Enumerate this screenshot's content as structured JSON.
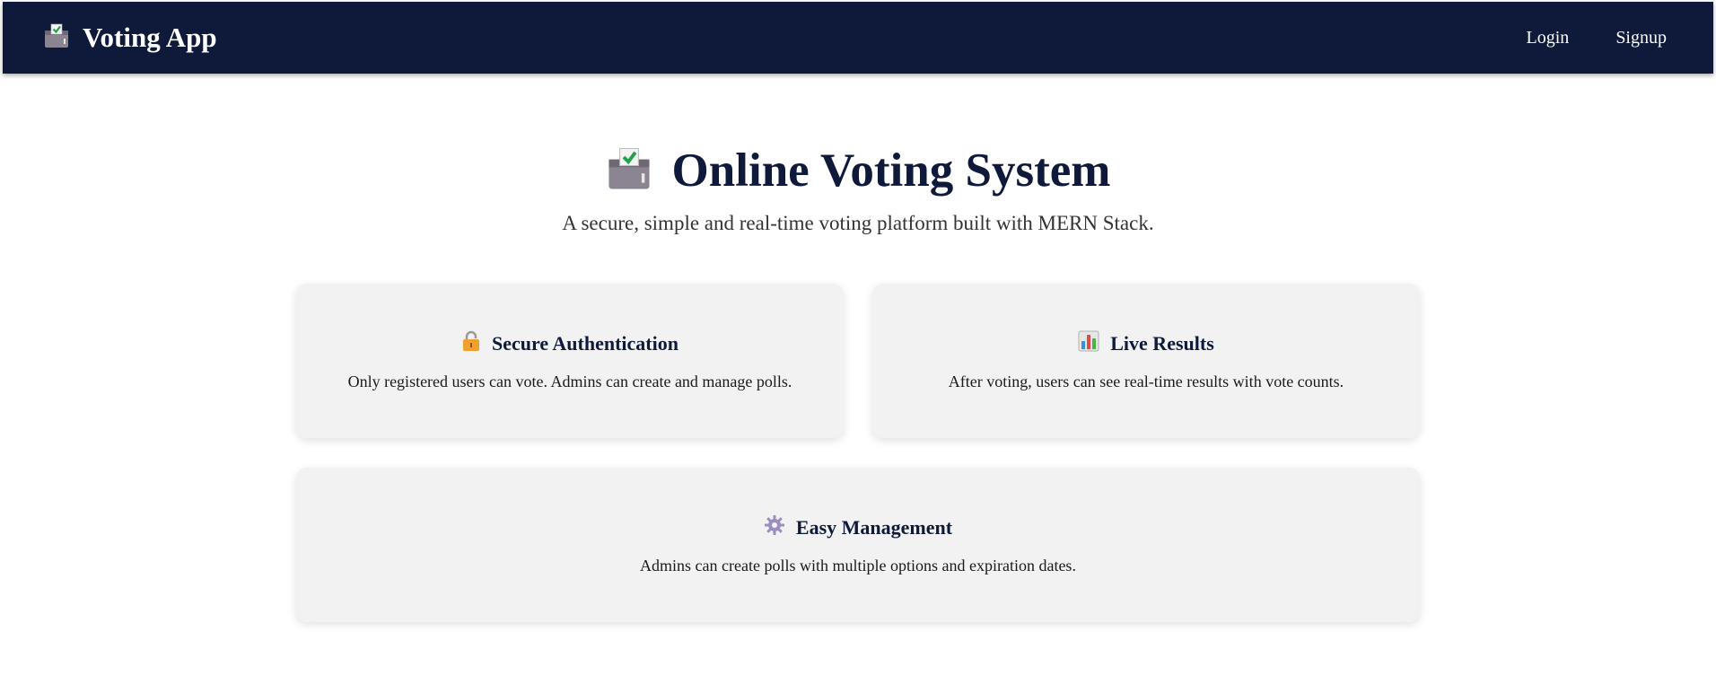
{
  "navbar": {
    "brand_icon": "ballot-box-icon",
    "brand_title": "Voting App",
    "links": [
      {
        "label": "Login"
      },
      {
        "label": "Signup"
      }
    ]
  },
  "hero": {
    "icon": "ballot-box-icon",
    "title": "Online Voting System",
    "subtitle": "A secure, simple and real-time voting platform built with MERN Stack."
  },
  "features": [
    {
      "icon": "lock-icon",
      "title": "Secure Authentication",
      "text": "Only registered users can vote. Admins can create and manage polls."
    },
    {
      "icon": "bar-chart-icon",
      "title": "Live Results",
      "text": "After voting, users can see real-time results with vote counts."
    },
    {
      "icon": "gear-icon",
      "title": "Easy Management",
      "text": "Admins can create polls with multiple options and expiration dates."
    }
  ],
  "colors": {
    "navbar_bg": "#0f1a3a",
    "card_bg": "#f2f2f2",
    "heading": "#0f1a3a"
  }
}
